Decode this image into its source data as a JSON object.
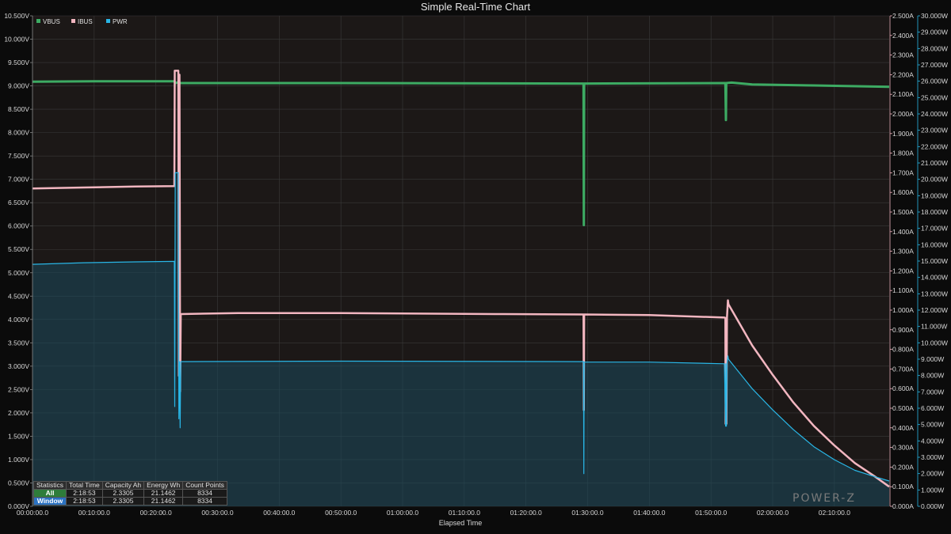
{
  "chart_data": {
    "type": "line",
    "title": "Simple Real-Time Chart",
    "xlabel": "Elapsed Time",
    "x_unit": "seconds",
    "xlim": [
      0,
      8333
    ],
    "x_tick_labels": [
      "00:00:00.0",
      "00:10:00.0",
      "00:20:00.0",
      "00:30:00.0",
      "00:40:00.0",
      "00:50:00.0",
      "01:00:00.0",
      "01:10:00.0",
      "01:20:00.0",
      "01:30:00.0",
      "01:40:00.0",
      "01:50:00.0",
      "02:00:00.0",
      "02:10:00.0"
    ],
    "axes": {
      "left": {
        "unit": "V",
        "ylim": [
          0,
          10.5
        ],
        "tick_labels": [
          "0.000V",
          "0.500V",
          "1.000V",
          "1.500V",
          "2.000V",
          "2.500V",
          "3.000V",
          "3.500V",
          "4.000V",
          "4.500V",
          "5.000V",
          "5.500V",
          "6.000V",
          "6.500V",
          "7.000V",
          "7.500V",
          "8.000V",
          "8.500V",
          "9.000V",
          "9.500V",
          "10.000V",
          "10.500V"
        ]
      },
      "right1": {
        "unit": "A",
        "ylim": [
          0,
          2.5
        ],
        "tick_labels": [
          "0.000A",
          "0.100A",
          "0.200A",
          "0.300A",
          "0.400A",
          "0.500A",
          "0.600A",
          "0.700A",
          "0.800A",
          "0.900A",
          "1.000A",
          "1.100A",
          "1.200A",
          "1.300A",
          "1.400A",
          "1.500A",
          "1.600A",
          "1.700A",
          "1.800A",
          "1.900A",
          "2.000A",
          "2.100A",
          "2.200A",
          "2.300A",
          "2.400A",
          "2.500A"
        ]
      },
      "right2": {
        "unit": "W",
        "ylim": [
          0,
          30
        ],
        "tick_labels": [
          "0.000W",
          "1.000W",
          "2.000W",
          "3.000W",
          "4.000W",
          "5.000W",
          "6.000W",
          "7.000W",
          "8.000W",
          "9.000W",
          "10.000W",
          "11.000W",
          "12.000W",
          "13.000W",
          "14.000W",
          "15.000W",
          "16.000W",
          "17.000W",
          "18.000W",
          "19.000W",
          "20.000W",
          "21.000W",
          "22.000W",
          "23.000W",
          "24.000W",
          "25.000W",
          "26.000W",
          "27.000W",
          "28.000W",
          "29.000W",
          "30.000W"
        ]
      }
    },
    "grid": true,
    "legend_position": "top-left",
    "series": [
      {
        "name": "VBUS",
        "axis": "left",
        "color": "#3dab63",
        "points": [
          [
            0,
            9.09
          ],
          [
            600,
            9.1
          ],
          [
            1380,
            9.1
          ],
          [
            1395,
            9.06
          ],
          [
            1420,
            9.08
          ],
          [
            1440,
            9.06
          ],
          [
            3000,
            9.06
          ],
          [
            5360,
            9.05
          ],
          [
            5363,
            6.02
          ],
          [
            5366,
            9.05
          ],
          [
            6740,
            9.06
          ],
          [
            6745,
            8.27
          ],
          [
            6748,
            9.06
          ],
          [
            6800,
            9.07
          ],
          [
            7000,
            9.03
          ],
          [
            7600,
            9.01
          ],
          [
            8333,
            8.98
          ]
        ]
      },
      {
        "name": "IBUS",
        "axis": "right1",
        "color": "#f2b6c0",
        "points": [
          [
            0,
            1.62
          ],
          [
            500,
            1.625
          ],
          [
            1000,
            1.63
          ],
          [
            1380,
            1.632
          ],
          [
            1384,
            2.22
          ],
          [
            1400,
            2.22
          ],
          [
            1410,
            2.22
          ],
          [
            1418,
            2.22
          ],
          [
            1424,
            0.665
          ],
          [
            1430,
            2.2
          ],
          [
            1436,
            0.585
          ],
          [
            1442,
            0.98
          ],
          [
            2000,
            0.985
          ],
          [
            3000,
            0.985
          ],
          [
            4500,
            0.98
          ],
          [
            5360,
            0.978
          ],
          [
            5363,
            0.49
          ],
          [
            5366,
            0.978
          ],
          [
            6000,
            0.975
          ],
          [
            6730,
            0.962
          ],
          [
            6740,
            0.96
          ],
          [
            6742,
            0.42
          ],
          [
            6744,
            0.96
          ],
          [
            6750,
            0.42
          ],
          [
            6755,
            0.96
          ],
          [
            6764,
            1.05
          ],
          [
            6770,
            1.03
          ],
          [
            7000,
            0.82
          ],
          [
            7200,
            0.67
          ],
          [
            7400,
            0.53
          ],
          [
            7600,
            0.41
          ],
          [
            7800,
            0.31
          ],
          [
            8000,
            0.22
          ],
          [
            8200,
            0.15
          ],
          [
            8333,
            0.1
          ]
        ]
      },
      {
        "name": "PWR",
        "axis": "right2",
        "color": "#29b6e6",
        "points": [
          [
            0,
            14.8
          ],
          [
            500,
            14.9
          ],
          [
            1000,
            14.95
          ],
          [
            1380,
            14.98
          ],
          [
            1384,
            6.1
          ],
          [
            1388,
            20.4
          ],
          [
            1400,
            20.4
          ],
          [
            1410,
            20.4
          ],
          [
            1418,
            20.4
          ],
          [
            1424,
            5.35
          ],
          [
            1430,
            8.85
          ],
          [
            1436,
            4.8
          ],
          [
            1442,
            8.85
          ],
          [
            3000,
            8.88
          ],
          [
            5360,
            8.85
          ],
          [
            5363,
            2.0
          ],
          [
            5366,
            8.82
          ],
          [
            6000,
            8.82
          ],
          [
            6730,
            8.72
          ],
          [
            6742,
            4.9
          ],
          [
            6744,
            8.72
          ],
          [
            6750,
            4.9
          ],
          [
            6755,
            8.72
          ],
          [
            6764,
            9.2
          ],
          [
            6770,
            9.0
          ],
          [
            7000,
            7.2
          ],
          [
            7200,
            5.9
          ],
          [
            7400,
            4.7
          ],
          [
            7600,
            3.65
          ],
          [
            7800,
            2.85
          ],
          [
            8000,
            2.2
          ],
          [
            8200,
            1.8
          ],
          [
            8333,
            1.55
          ]
        ]
      }
    ]
  },
  "stats": {
    "headers": [
      "Statistics",
      "Total Time",
      "Capacity Ah",
      "Energy Wh",
      "Count Points"
    ],
    "rows": [
      {
        "label": "All",
        "total_time": "2:18:53",
        "capacity": "2.3305",
        "energy": "21.1462",
        "count": "8334"
      },
      {
        "label": "Window",
        "total_time": "2:18:53",
        "capacity": "2.3305",
        "energy": "21.1462",
        "count": "8334"
      }
    ]
  },
  "logo_text": "POWER-Z"
}
